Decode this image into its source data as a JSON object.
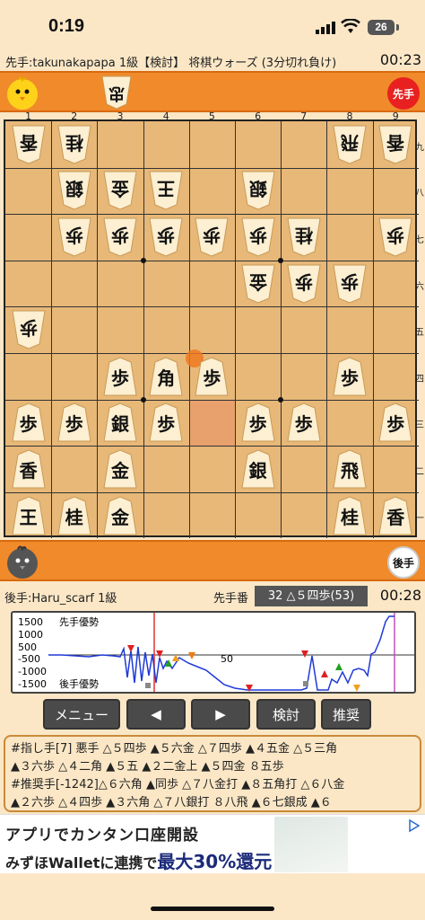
{
  "status": {
    "time": "0:19",
    "battery": "26"
  },
  "header": {
    "info": "先手:takunakapapa 1級【検討】 将棋ウォーズ (3分切れ負け)",
    "time": "00:23"
  },
  "top_hand": {
    "piece": "忠",
    "button": "先手"
  },
  "bottom_hand": {
    "button": "後手"
  },
  "board": {
    "files": [
      "1",
      "2",
      "3",
      "4",
      "5",
      "6",
      "7",
      "8",
      "9"
    ],
    "ranks": [
      "九",
      "八",
      "七",
      "六",
      "五",
      "四",
      "三",
      "二",
      "一"
    ],
    "pieces": [
      {
        "c": 0,
        "r": 0,
        "t": "香",
        "f": true
      },
      {
        "c": 1,
        "r": 0,
        "t": "桂",
        "f": true
      },
      {
        "c": 7,
        "r": 0,
        "t": "飛",
        "f": true
      },
      {
        "c": 8,
        "r": 0,
        "t": "香",
        "f": true
      },
      {
        "c": 1,
        "r": 1,
        "t": "銀",
        "f": true
      },
      {
        "c": 2,
        "r": 1,
        "t": "金",
        "f": true
      },
      {
        "c": 3,
        "r": 1,
        "t": "王",
        "f": true
      },
      {
        "c": 5,
        "r": 1,
        "t": "銀",
        "f": true
      },
      {
        "c": 1,
        "r": 2,
        "t": "歩",
        "f": true
      },
      {
        "c": 2,
        "r": 2,
        "t": "歩",
        "f": true
      },
      {
        "c": 3,
        "r": 2,
        "t": "歩",
        "f": true
      },
      {
        "c": 4,
        "r": 2,
        "t": "歩",
        "f": true
      },
      {
        "c": 5,
        "r": 2,
        "t": "歩",
        "f": true
      },
      {
        "c": 6,
        "r": 2,
        "t": "桂",
        "f": true
      },
      {
        "c": 8,
        "r": 2,
        "t": "歩",
        "f": true
      },
      {
        "c": 5,
        "r": 3,
        "t": "金",
        "f": true
      },
      {
        "c": 6,
        "r": 3,
        "t": "歩",
        "f": true
      },
      {
        "c": 7,
        "r": 3,
        "t": "歩",
        "f": true
      },
      {
        "c": 0,
        "r": 4,
        "t": "歩",
        "f": true
      },
      {
        "c": 2,
        "r": 5,
        "t": "歩",
        "f": false
      },
      {
        "c": 3,
        "r": 5,
        "t": "角",
        "f": false
      },
      {
        "c": 4,
        "r": 5,
        "t": "歩",
        "f": false
      },
      {
        "c": 7,
        "r": 5,
        "t": "歩",
        "f": false
      },
      {
        "c": 0,
        "r": 6,
        "t": "歩",
        "f": false
      },
      {
        "c": 1,
        "r": 6,
        "t": "歩",
        "f": false
      },
      {
        "c": 2,
        "r": 6,
        "t": "銀",
        "f": false
      },
      {
        "c": 3,
        "r": 6,
        "t": "歩",
        "f": false
      },
      {
        "c": 5,
        "r": 6,
        "t": "歩",
        "f": false
      },
      {
        "c": 6,
        "r": 6,
        "t": "歩",
        "f": false
      },
      {
        "c": 8,
        "r": 6,
        "t": "歩",
        "f": false
      },
      {
        "c": 0,
        "r": 7,
        "t": "香",
        "f": false
      },
      {
        "c": 2,
        "r": 7,
        "t": "金",
        "f": false
      },
      {
        "c": 5,
        "r": 7,
        "t": "銀",
        "f": false
      },
      {
        "c": 7,
        "r": 7,
        "t": "飛",
        "f": false
      },
      {
        "c": 0,
        "r": 8,
        "t": "王",
        "f": false
      },
      {
        "c": 1,
        "r": 8,
        "t": "桂",
        "f": false
      },
      {
        "c": 2,
        "r": 8,
        "t": "金",
        "f": false
      },
      {
        "c": 7,
        "r": 8,
        "t": "桂",
        "f": false
      },
      {
        "c": 8,
        "r": 8,
        "t": "香",
        "f": false
      }
    ]
  },
  "statusline": {
    "bottom_player": "後手:Haru_scarf 1級",
    "turn_label": "先手番",
    "move": "32 △５四歩(53)",
    "time": "00:28"
  },
  "chart": {
    "labels": {
      "y1": "1500",
      "y2": "1000",
      "y3": "500",
      "y4": "-500",
      "y5": "-1000",
      "y6": "-1500",
      "top": "先手優勢",
      "bottom": "後手優勢",
      "mid": "50"
    }
  },
  "buttons": {
    "menu": "メニュー",
    "prev": "◀",
    "next": "▶",
    "review": "検討",
    "recommend": "推奨"
  },
  "moves": {
    "line1": "#指し手[7] 悪手 △５四歩 ▲５六金 △７四歩 ▲４五金 △５三角",
    "line2": "▲３六歩 △４二角 ▲５五 ▲２二金上 ▲５四金 ８五歩",
    "line3": "#推奨手[-1242]△６六角 ▲同歩 △７八金打 ▲８五角打 △６八金",
    "line4": "▲２六歩 △４四歩 ▲３六角 △７八銀打 ８八飛 ▲６七銀成 ▲６"
  },
  "ad": {
    "line1": "アプリでカンタン口座開設",
    "line2a": "みずほWalletに連携で",
    "line2b": "最大30%還元"
  }
}
